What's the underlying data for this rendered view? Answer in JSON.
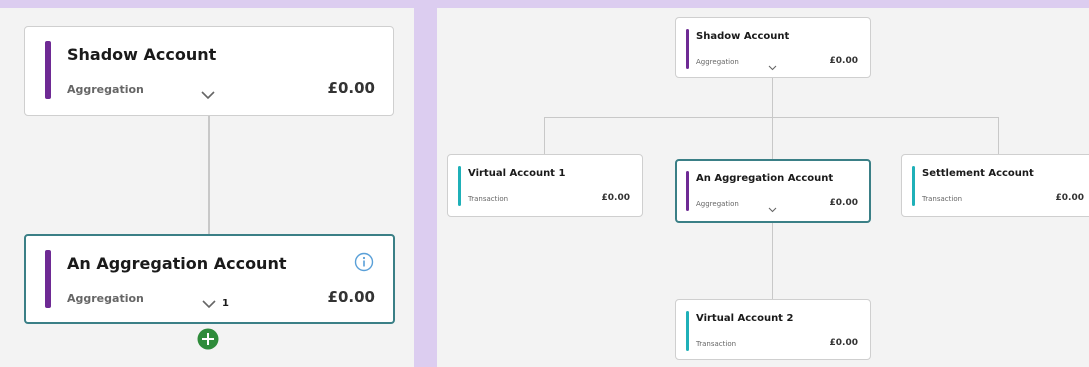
{
  "left_panel": {
    "shadow": {
      "title": "Shadow Account",
      "type": "Aggregation",
      "balance": "£0.00"
    },
    "aggregation": {
      "title": "An Aggregation Account",
      "type": "Aggregation",
      "balance": "£0.00",
      "child_count": "1"
    }
  },
  "right_panel": {
    "shadow": {
      "title": "Shadow Account",
      "type": "Aggregation",
      "balance": "£0.00"
    },
    "virtual1": {
      "title": "Virtual Account 1",
      "type": "Transaction",
      "balance": "£0.00"
    },
    "aggregation": {
      "title": "An Aggregation Account",
      "type": "Aggregation",
      "balance": "£0.00"
    },
    "settlement": {
      "title": "Settlement Account",
      "type": "Transaction",
      "balance": "£0.00"
    },
    "virtual2": {
      "title": "Virtual Account 2",
      "type": "Transaction",
      "balance": "£0.00"
    }
  },
  "colors": {
    "aggregation_bar": "#6e2a94",
    "transaction_bar": "#1fb0b8",
    "selected_border": "#3a7f86",
    "add_button": "#2e8b3a"
  }
}
